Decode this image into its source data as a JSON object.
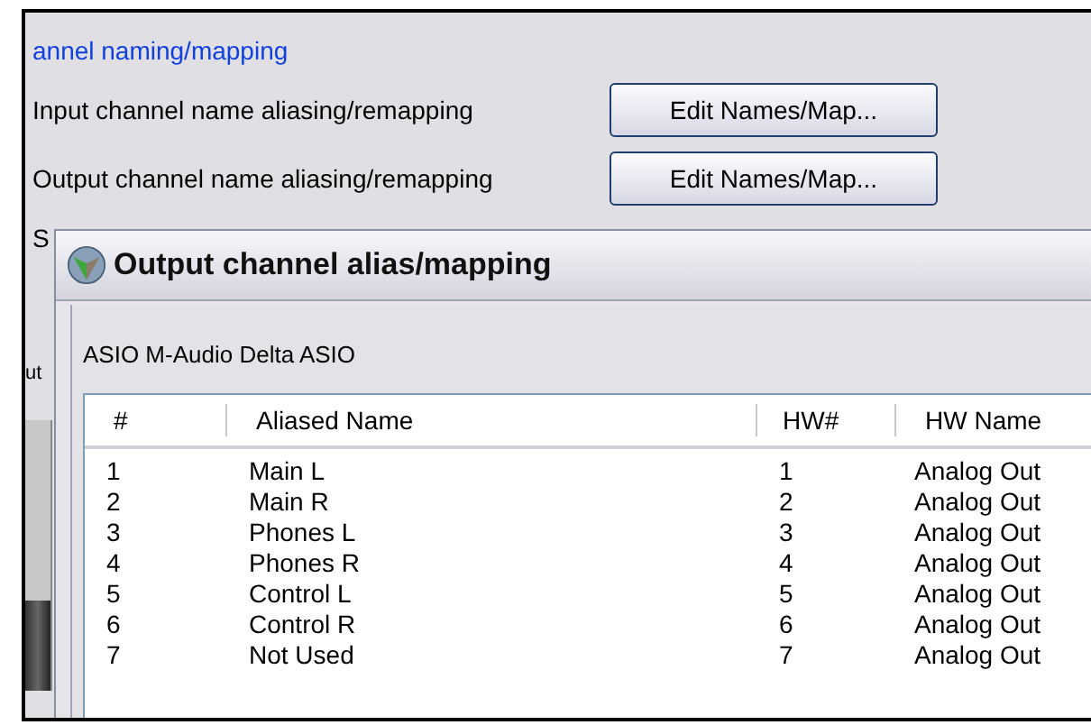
{
  "group": {
    "title": "annel naming/mapping",
    "rows": [
      {
        "label": "Input channel name aliasing/remapping",
        "button": "Edit Names/Map..."
      },
      {
        "label": "Output channel name aliasing/remapping",
        "button": "Edit Names/Map..."
      }
    ],
    "partial_labels": [
      "S",
      "ut"
    ]
  },
  "dialog": {
    "title": "Output channel alias/mapping",
    "device": "ASIO M-Audio Delta ASIO",
    "columns": [
      "#",
      "Aliased Name",
      "HW#",
      "HW Name"
    ],
    "rows": [
      [
        "1",
        "Main L",
        "1",
        "Analog Out"
      ],
      [
        "2",
        "Main R",
        "2",
        "Analog Out"
      ],
      [
        "3",
        "Phones L",
        "3",
        "Analog Out"
      ],
      [
        "4",
        "Phones R",
        "4",
        "Analog Out"
      ],
      [
        "5",
        "Control L",
        "5",
        "Analog Out"
      ],
      [
        "6",
        "Control R",
        "6",
        "Analog Out"
      ],
      [
        "7",
        "Not Used",
        "7",
        "Analog Out"
      ]
    ]
  }
}
